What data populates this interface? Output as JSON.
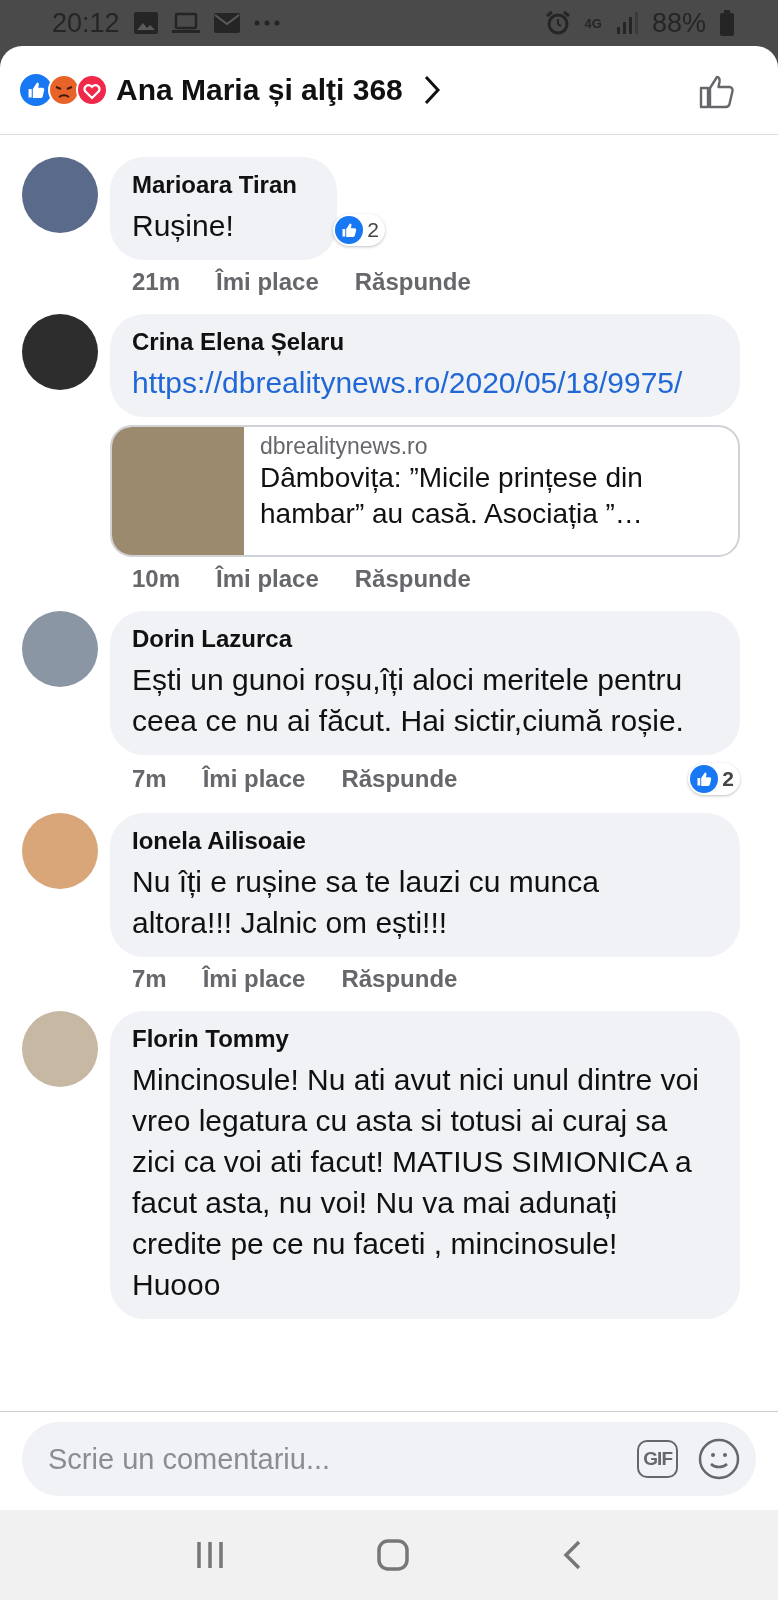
{
  "status_bar": {
    "time": "20:12",
    "network_type": "4G",
    "battery": "88%"
  },
  "header": {
    "title": "Ana Maria și alţi 368"
  },
  "comments": [
    {
      "kind": "text",
      "author": "Marioara Tiran",
      "text": "Rușine!",
      "time": "21m",
      "like": "Îmi place",
      "reply": "Răspunde",
      "reactions": {
        "count": "2",
        "on_bubble": true
      }
    },
    {
      "kind": "link",
      "author": "Crina Elena Șelaru",
      "text": "https://dbrealitynews.ro/2020/05/18/9975/",
      "preview": {
        "domain": "dbrealitynews.ro",
        "title": "Dâmbovița: ”Micile prințese din hambar” au casă. Asociația ”…"
      },
      "time": "10m",
      "like": "Îmi place",
      "reply": "Răspunde"
    },
    {
      "kind": "text",
      "author": "Dorin Lazurca",
      "text": "Ești un gunoi roșu,îți aloci meritele pentru ceea ce nu ai făcut. Hai sictir,ciumă roșie.",
      "time": "7m",
      "like": "Îmi place",
      "reply": "Răspunde",
      "reactions": {
        "count": "2",
        "on_bubble": false
      }
    },
    {
      "kind": "text",
      "author": "Ionela Ailisoaie",
      "text": "Nu îți e rușine sa te lauzi cu munca altora!!! Jalnic om ești!!!",
      "time": "7m",
      "like": "Îmi place",
      "reply": "Răspunde"
    },
    {
      "kind": "text",
      "author": "Florin Tommy",
      "text": "Mincinosule! Nu ati avut nici unul dintre voi vreo legatura cu asta si totusi ai curaj sa zici ca voi ati facut! MATIUS SIMIONICA a facut asta, nu voi! Nu va mai adunați credite pe ce nu faceti , mincinosule! Huooo"
    }
  ],
  "composer": {
    "placeholder": "Scrie un comentariu...",
    "gif_label": "GIF"
  }
}
